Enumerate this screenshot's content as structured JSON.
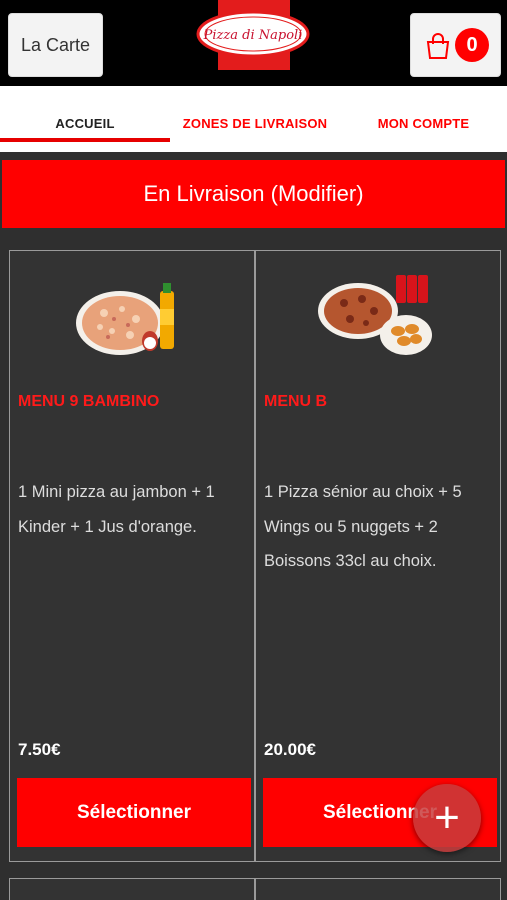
{
  "header": {
    "menu_button_label": "La Carte",
    "logo_text": "Pizza di Napoli",
    "cart_count": "0"
  },
  "tabs": [
    {
      "label": "ACCUEIL",
      "active": true
    },
    {
      "label": "ZONES DE LIVRAISON",
      "active": false
    },
    {
      "label": "MON COMPTE",
      "active": false
    }
  ],
  "delivery_banner": "En Livraison (Modifier)",
  "products": [
    {
      "title": "MENU 9 BAMBINO",
      "description": "1 Mini pizza au jambon  + 1 Kinder  + 1 Jus d'orange.",
      "price": "7.50€",
      "button": "Sélectionner",
      "image": "pizza-kinder-juice-image"
    },
    {
      "title": "MENU B",
      "description": "1 Pizza sénior au choix  + 5 Wings ou 5 nuggets  + 2 Boissons 33cl au choix.",
      "price": "20.00€",
      "button": "Sélectionner",
      "image": "pizza-cans-wings-image"
    }
  ],
  "fab_icon": "plus-icon",
  "colors": {
    "accent": "#ff0000",
    "header_bg": "#000000",
    "content_bg": "#2f2f2f"
  }
}
